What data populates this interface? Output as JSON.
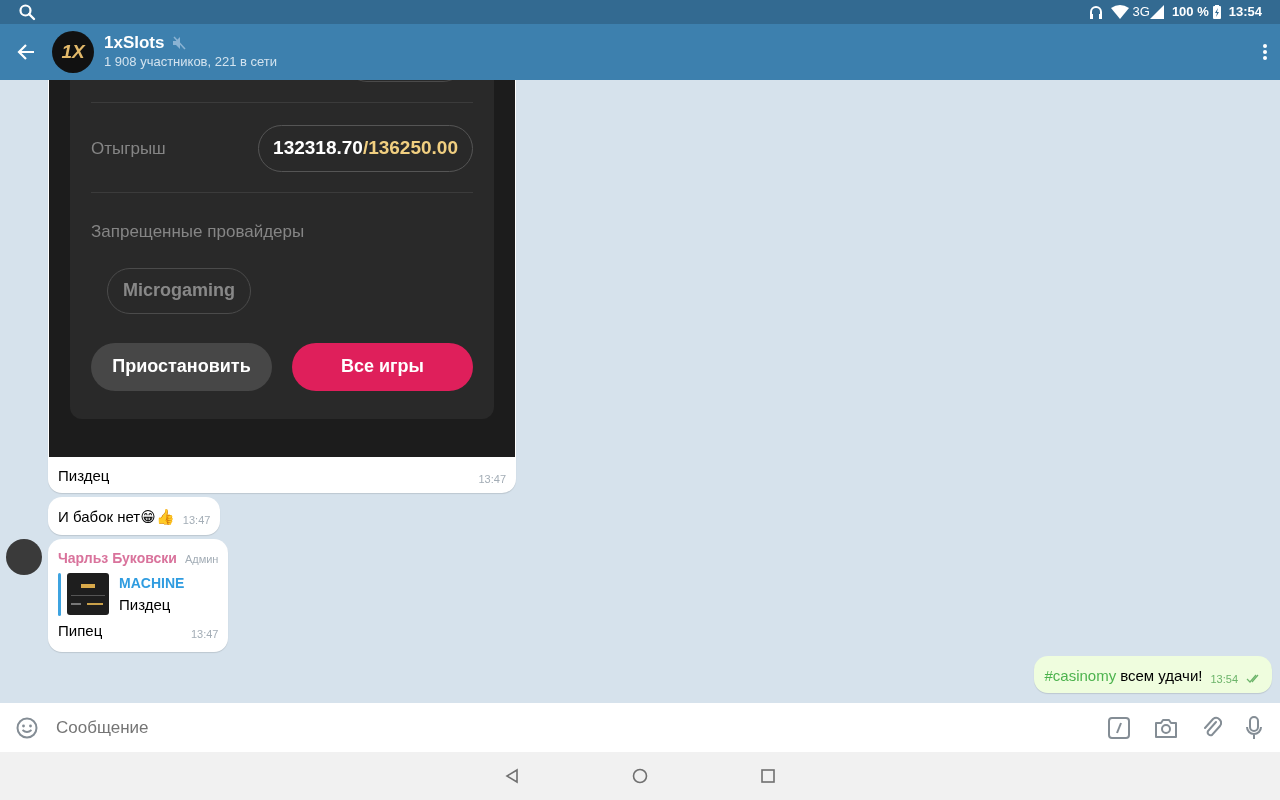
{
  "status_bar": {
    "network": "3G",
    "battery": "100 %",
    "time": "13:54"
  },
  "header": {
    "logo_text": "1X",
    "title": "1xSlots",
    "muted": true,
    "subtitle": "1 908 участников, 221 в сети"
  },
  "messages": [
    {
      "kind": "photo",
      "outgoing": false,
      "screenshot": {
        "row_label": "Отыгрыш",
        "wagered": "132318.70",
        "separator": "/",
        "required": "136250.00",
        "providers_label": "Запрещенные провайдеры",
        "providers": [
          "Microgaming"
        ],
        "buttons": [
          {
            "label": "Приостановить",
            "primary": false
          },
          {
            "label": "Все игры",
            "primary": true
          }
        ]
      },
      "text": "Пиздец",
      "time": "13:47"
    },
    {
      "kind": "text",
      "outgoing": false,
      "text": "И бабок нет😁👍",
      "time": "13:47"
    },
    {
      "kind": "reply",
      "outgoing": false,
      "author": "Чарльз Буковски",
      "role": "Админ",
      "reply": {
        "author": "MACHINE",
        "text": "Пиздец"
      },
      "text": "Пипец",
      "time": "13:47"
    },
    {
      "kind": "hashtag",
      "outgoing": true,
      "hashtag": "#casinomy",
      "text": "всем удачи!",
      "time": "13:54",
      "read": true
    }
  ],
  "composer": {
    "placeholder": "Сообщение"
  }
}
